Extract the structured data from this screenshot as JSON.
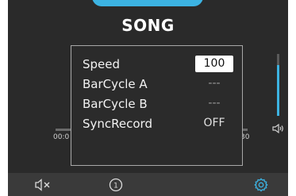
{
  "screen": {
    "title": "SONG"
  },
  "player": {
    "time_start": "00:0",
    "time_end": "30",
    "volume_level": 0.82
  },
  "settings_dialog": {
    "rows": [
      {
        "label": "Speed",
        "value": "100"
      },
      {
        "label": "BarCycle A",
        "value": "---"
      },
      {
        "label": "BarCycle B",
        "value": "---"
      },
      {
        "label": "SyncRecord",
        "value": "OFF"
      }
    ]
  },
  "bottom_bar": {
    "mute_icon": "speaker-muted-icon",
    "number_icon": "circled-one-icon",
    "number_label": "1",
    "settings_icon": "gear-icon"
  },
  "colors": {
    "accent": "#3cb3e2",
    "background": "#2a2a2a",
    "dialog_border": "#a8a8a8"
  }
}
